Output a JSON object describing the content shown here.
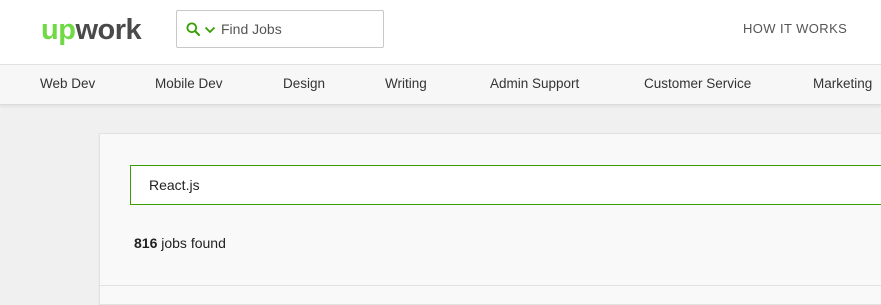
{
  "header": {
    "logo_up": "up",
    "logo_work": "work",
    "search": {
      "placeholder": "Find Jobs",
      "value": ""
    },
    "how_it_works": "HOW IT WORKS"
  },
  "categories": [
    "Web Dev",
    "Mobile Dev",
    "Design",
    "Writing",
    "Admin Support",
    "Customer Service",
    "Marketing"
  ],
  "main": {
    "query": "React.js",
    "jobs_count": "816",
    "jobs_suffix": " jobs found"
  },
  "colors": {
    "brand_green": "#6fda44",
    "accent_green": "#37a000",
    "text": "#222222"
  },
  "icons": {
    "search": "search-icon",
    "chevron": "chevron-down-icon"
  }
}
